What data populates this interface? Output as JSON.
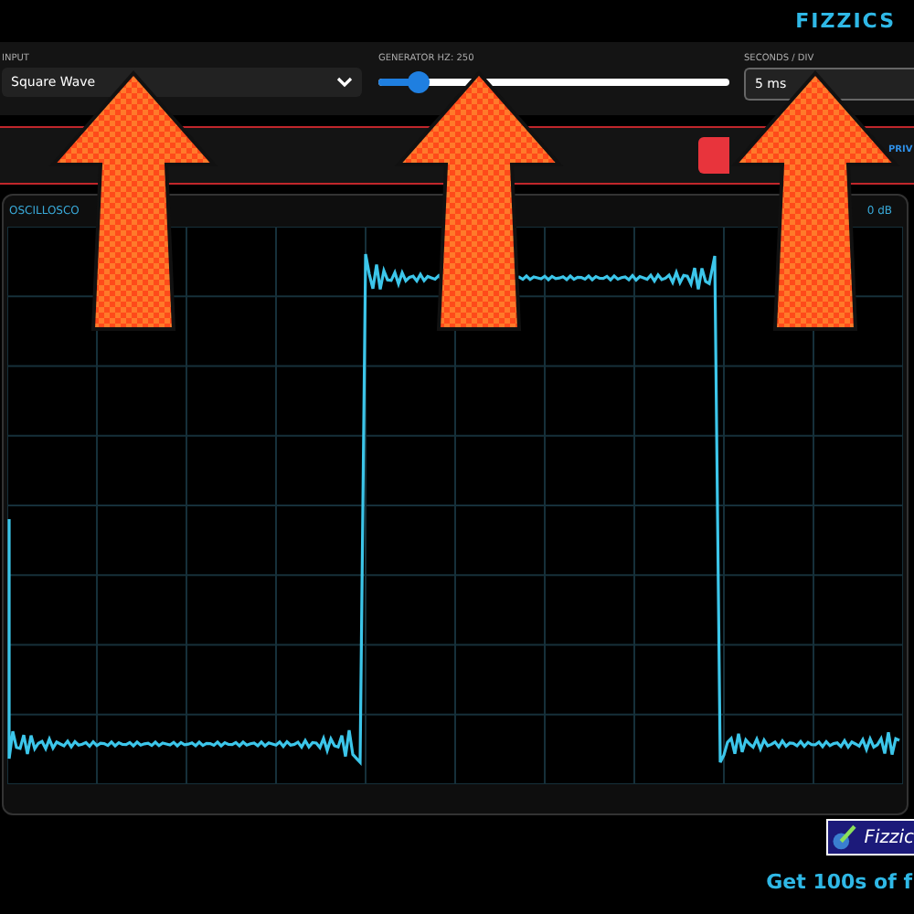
{
  "header": {
    "title": "FIZZICS"
  },
  "controls": {
    "input": {
      "label": "INPUT",
      "value": "Square Wave"
    },
    "generator": {
      "label": "GENERATOR HZ: 250",
      "level": 0.12
    },
    "seconds_per_div": {
      "label": "SECONDS / DIV",
      "value": "5 ms"
    }
  },
  "action_bar": {
    "note_lines": [
      "PRIV"
    ]
  },
  "oscilloscope": {
    "title": "OSCILLOSCO",
    "reading": "0 dB"
  },
  "promo": {
    "badge": "Fizzic",
    "text": "Get 100s of f"
  }
}
